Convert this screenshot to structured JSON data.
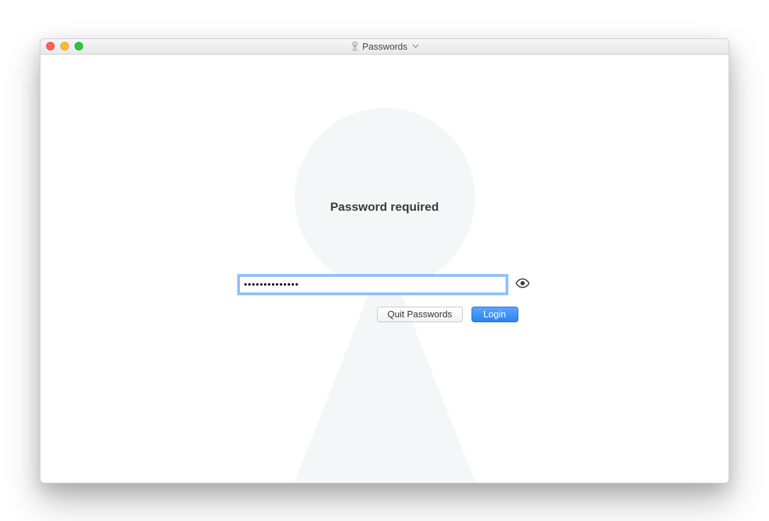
{
  "window": {
    "title": "Passwords"
  },
  "main": {
    "heading": "Password required",
    "password_value": "••••••••••••••",
    "password_placeholder": ""
  },
  "buttons": {
    "quit_label": "Quit Passwords",
    "login_label": "Login"
  },
  "icons": {
    "app": "keyhole-icon",
    "chevron": "chevron-down-icon",
    "eye": "eye-icon"
  }
}
